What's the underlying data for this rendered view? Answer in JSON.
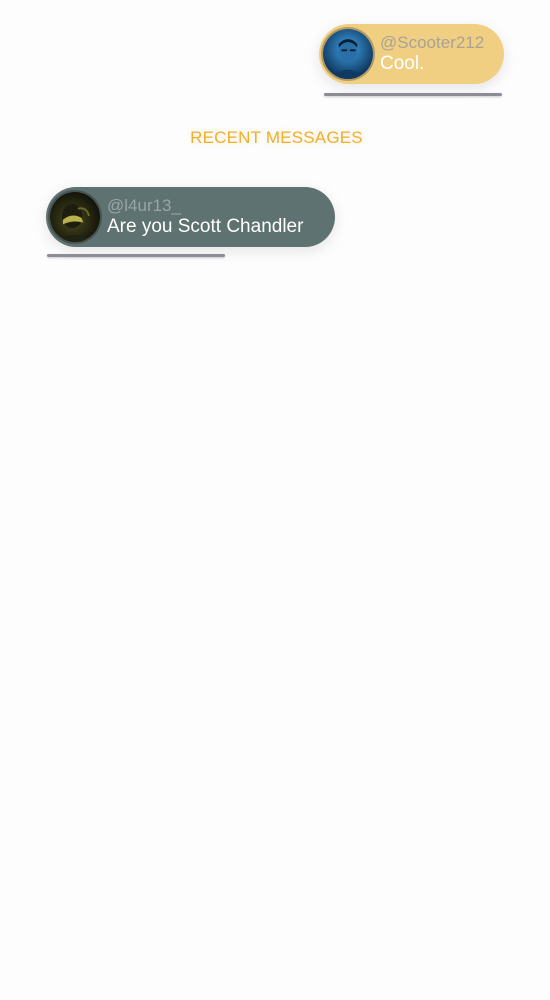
{
  "section_title": "RECENT MESSAGES",
  "messages": [
    {
      "handle": "@Scooter212",
      "text": "Cool.",
      "bubble_color": "#f0cf82",
      "avatar_icon": "user-avatar-icon"
    },
    {
      "handle": "@l4ur13_",
      "text": "Are you Scott Chandler",
      "bubble_color": "#5e7271",
      "avatar_icon": "user-avatar-icon"
    }
  ],
  "colors": {
    "accent": "#eeaf2e",
    "underline": "#8c8c94",
    "background": "#fdfdfd"
  }
}
